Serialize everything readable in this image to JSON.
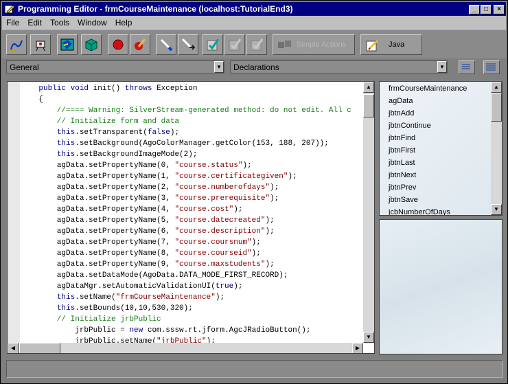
{
  "window": {
    "title": "Programming Editor - frmCourseMaintenance  (localhost:TutorialEnd3)",
    "minimize_label": "_",
    "maximize_label": "□",
    "close_label": "×"
  },
  "menu": [
    "File",
    "Edit",
    "Tools",
    "Window",
    "Help"
  ],
  "toolbar": {
    "icons": [
      "event-wizard-icon",
      "sql-wizard-icon",
      "properties-icon",
      "compile-icon",
      "record-icon",
      "pencil-red-icon",
      "paintbrush-icon",
      "pen-arrow-icon",
      "check-edit-icon",
      "check-disabled-icon",
      "check-disabled-icon"
    ],
    "simple_actions_label": "Simple Actions",
    "java_label": "Java"
  },
  "selectors": {
    "object": "General",
    "procedure": "Declarations"
  },
  "code_lines": [
    [
      {
        "t": "    "
      },
      {
        "c": "kw",
        "t": "public void"
      },
      {
        "t": " init() "
      },
      {
        "c": "kw",
        "t": "throws"
      },
      {
        "t": " Exception"
      }
    ],
    [
      {
        "t": "    {"
      }
    ],
    [
      {
        "c": "cm",
        "t": "        //==== Warning: SilverStream-generated method: do not edit. All c"
      }
    ],
    [
      {
        "c": "cm",
        "t": "        // Initialize form and data"
      }
    ],
    [
      {
        "t": "        "
      },
      {
        "c": "kw",
        "t": "this"
      },
      {
        "t": ".setTransparent("
      },
      {
        "c": "kw",
        "t": "false"
      },
      {
        "t": ");"
      }
    ],
    [
      {
        "t": "        "
      },
      {
        "c": "kw",
        "t": "this"
      },
      {
        "t": ".setBackground(AgoColorManager.getColor(153, 188, 207));"
      }
    ],
    [
      {
        "t": "        "
      },
      {
        "c": "kw",
        "t": "this"
      },
      {
        "t": ".setBackgroundImageMode(2);"
      }
    ],
    [
      {
        "t": "        agData.setPropertyName(0, "
      },
      {
        "c": "st",
        "t": "\"course.status\""
      },
      {
        "t": ");"
      }
    ],
    [
      {
        "t": "        agData.setPropertyName(1, "
      },
      {
        "c": "st",
        "t": "\"course.certificategiven\""
      },
      {
        "t": ");"
      }
    ],
    [
      {
        "t": "        agData.setPropertyName(2, "
      },
      {
        "c": "st",
        "t": "\"course.numberofdays\""
      },
      {
        "t": ");"
      }
    ],
    [
      {
        "t": "        agData.setPropertyName(3, "
      },
      {
        "c": "st",
        "t": "\"course.prerequisite\""
      },
      {
        "t": ");"
      }
    ],
    [
      {
        "t": "        agData.setPropertyName(4, "
      },
      {
        "c": "st",
        "t": "\"course.cost\""
      },
      {
        "t": ");"
      }
    ],
    [
      {
        "t": "        agData.setPropertyName(5, "
      },
      {
        "c": "st",
        "t": "\"course.datecreated\""
      },
      {
        "t": ");"
      }
    ],
    [
      {
        "t": "        agData.setPropertyName(6, "
      },
      {
        "c": "st",
        "t": "\"course.description\""
      },
      {
        "t": ");"
      }
    ],
    [
      {
        "t": "        agData.setPropertyName(7, "
      },
      {
        "c": "st",
        "t": "\"course.coursnum\""
      },
      {
        "t": ");"
      }
    ],
    [
      {
        "t": "        agData.setPropertyName(8, "
      },
      {
        "c": "st",
        "t": "\"course.courseid\""
      },
      {
        "t": ");"
      }
    ],
    [
      {
        "t": "        agData.setPropertyName(9, "
      },
      {
        "c": "st",
        "t": "\"course.maxstudents\""
      },
      {
        "t": ");"
      }
    ],
    [
      {
        "t": "        agData.setDataMode(AgoData.DATA_MODE_FIRST_RECORD);"
      }
    ],
    [
      {
        "t": "        agDataMgr.setAutomaticValidationUI("
      },
      {
        "c": "kw",
        "t": "true"
      },
      {
        "t": ");"
      }
    ],
    [
      {
        "t": "        "
      },
      {
        "c": "kw",
        "t": "this"
      },
      {
        "t": ".setName("
      },
      {
        "c": "st",
        "t": "\"frmCourseMaintenance\""
      },
      {
        "t": ");"
      }
    ],
    [
      {
        "t": "        "
      },
      {
        "c": "kw",
        "t": "this"
      },
      {
        "t": ".setBounds(10,10,530,320);"
      }
    ],
    [
      {
        "c": "cm",
        "t": "        // Initialize jrbPublic"
      }
    ],
    [
      {
        "t": "            jrbPublic = "
      },
      {
        "c": "kw",
        "t": "new"
      },
      {
        "t": " com.sssw.rt.jform.AgcJRadioButton();"
      }
    ],
    [
      {
        "t": "            jrbPublic.setName("
      },
      {
        "c": "st",
        "t": "\"jrbPublic\""
      },
      {
        "t": ");"
      }
    ]
  ],
  "objects_list": [
    "frmCourseMaintenance",
    "agData",
    "jbtnAdd",
    "jbtnContinue",
    "jbtnFind",
    "jbtnFirst",
    "jbtnLast",
    "jbtnNext",
    "jbtnPrev",
    "jbtnSave",
    "jcbNumberOfDays"
  ]
}
